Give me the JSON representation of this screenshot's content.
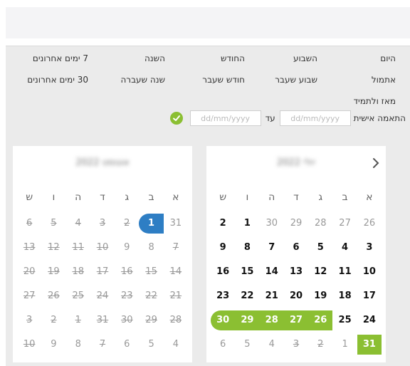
{
  "presets": {
    "today": "היום",
    "this_week": "השבוע",
    "this_month": "החודש",
    "this_year": "השנה",
    "last_7_days": "7 ימים אחרונים",
    "yesterday": "אתמול",
    "last_week": "שבוע שעבר",
    "last_month": "חודש שעבר",
    "last_year": "שנה שעברה",
    "last_30_days": "30 ימים אחרונים",
    "since_ever": "מאז ולתמיד"
  },
  "custom": {
    "label": "התאמה אישית",
    "from_placeholder": "dd/mm/yyyy",
    "until_label": "עד",
    "to_placeholder": "dd/mm/yyyy"
  },
  "weekdays": [
    "א",
    "ב",
    "ג",
    "ד",
    "ה",
    "ו",
    "ש"
  ],
  "colors": {
    "accent_green": "#8bbf32",
    "today_blue": "#2e7ec4"
  },
  "calendars": [
    {
      "title": "יולי 2022",
      "rows": [
        [
          {
            "d": "26",
            "s": "other"
          },
          {
            "d": "27",
            "s": "other"
          },
          {
            "d": "28",
            "s": "other"
          },
          {
            "d": "29",
            "s": "other"
          },
          {
            "d": "30",
            "s": "other"
          },
          {
            "d": "1",
            "s": "active"
          },
          {
            "d": "2",
            "s": "active"
          }
        ],
        [
          {
            "d": "3",
            "s": "active"
          },
          {
            "d": "4",
            "s": "active"
          },
          {
            "d": "5",
            "s": "active"
          },
          {
            "d": "6",
            "s": "active"
          },
          {
            "d": "7",
            "s": "active"
          },
          {
            "d": "8",
            "s": "active"
          },
          {
            "d": "9",
            "s": "active"
          }
        ],
        [
          {
            "d": "10",
            "s": "active"
          },
          {
            "d": "11",
            "s": "active"
          },
          {
            "d": "12",
            "s": "active"
          },
          {
            "d": "13",
            "s": "active"
          },
          {
            "d": "14",
            "s": "active"
          },
          {
            "d": "15",
            "s": "active"
          },
          {
            "d": "16",
            "s": "active"
          }
        ],
        [
          {
            "d": "17",
            "s": "active"
          },
          {
            "d": "18",
            "s": "active"
          },
          {
            "d": "19",
            "s": "active"
          },
          {
            "d": "20",
            "s": "active"
          },
          {
            "d": "21",
            "s": "active"
          },
          {
            "d": "22",
            "s": "active"
          },
          {
            "d": "23",
            "s": "active"
          }
        ],
        [
          {
            "d": "24",
            "s": "active"
          },
          {
            "d": "25",
            "s": "active"
          },
          {
            "d": "26",
            "s": "range range-start"
          },
          {
            "d": "27",
            "s": "range"
          },
          {
            "d": "28",
            "s": "range"
          },
          {
            "d": "29",
            "s": "range"
          },
          {
            "d": "30",
            "s": "range range-end"
          }
        ],
        [
          {
            "d": "31",
            "s": "sel"
          },
          {
            "d": "1",
            "s": "other"
          },
          {
            "d": "2",
            "s": "disabled"
          },
          {
            "d": "3",
            "s": "disabled"
          },
          {
            "d": "4",
            "s": "other"
          },
          {
            "d": "5",
            "s": "other"
          },
          {
            "d": "6",
            "s": "other"
          }
        ]
      ]
    },
    {
      "title": "אוגוסט 2022",
      "rows": [
        [
          {
            "d": "31",
            "s": "other"
          },
          {
            "d": "1",
            "s": "today"
          },
          {
            "d": "2",
            "s": "disabled"
          },
          {
            "d": "3",
            "s": "disabled"
          },
          {
            "d": "4",
            "s": "disabled"
          },
          {
            "d": "5",
            "s": "disabled"
          },
          {
            "d": "6",
            "s": "disabled"
          }
        ],
        [
          {
            "d": "7",
            "s": "disabled"
          },
          {
            "d": "8",
            "s": "other"
          },
          {
            "d": "9",
            "s": "other"
          },
          {
            "d": "10",
            "s": "disabled"
          },
          {
            "d": "11",
            "s": "disabled"
          },
          {
            "d": "12",
            "s": "disabled"
          },
          {
            "d": "13",
            "s": "disabled"
          }
        ],
        [
          {
            "d": "14",
            "s": "disabled"
          },
          {
            "d": "15",
            "s": "disabled"
          },
          {
            "d": "16",
            "s": "disabled"
          },
          {
            "d": "17",
            "s": "disabled"
          },
          {
            "d": "18",
            "s": "disabled"
          },
          {
            "d": "19",
            "s": "disabled"
          },
          {
            "d": "20",
            "s": "disabled"
          }
        ],
        [
          {
            "d": "21",
            "s": "disabled"
          },
          {
            "d": "22",
            "s": "disabled"
          },
          {
            "d": "23",
            "s": "disabled"
          },
          {
            "d": "24",
            "s": "disabled"
          },
          {
            "d": "25",
            "s": "disabled"
          },
          {
            "d": "26",
            "s": "disabled"
          },
          {
            "d": "27",
            "s": "disabled"
          }
        ],
        [
          {
            "d": "28",
            "s": "disabled"
          },
          {
            "d": "29",
            "s": "disabled"
          },
          {
            "d": "30",
            "s": "disabled"
          },
          {
            "d": "31",
            "s": "disabled"
          },
          {
            "d": "1",
            "s": "disabled"
          },
          {
            "d": "2",
            "s": "disabled"
          },
          {
            "d": "3",
            "s": "disabled"
          }
        ],
        [
          {
            "d": "4",
            "s": "other"
          },
          {
            "d": "5",
            "s": "other"
          },
          {
            "d": "6",
            "s": "other"
          },
          {
            "d": "7",
            "s": "disabled"
          },
          {
            "d": "8",
            "s": "other"
          },
          {
            "d": "9",
            "s": "other"
          },
          {
            "d": "10",
            "s": "disabled"
          }
        ]
      ]
    }
  ]
}
